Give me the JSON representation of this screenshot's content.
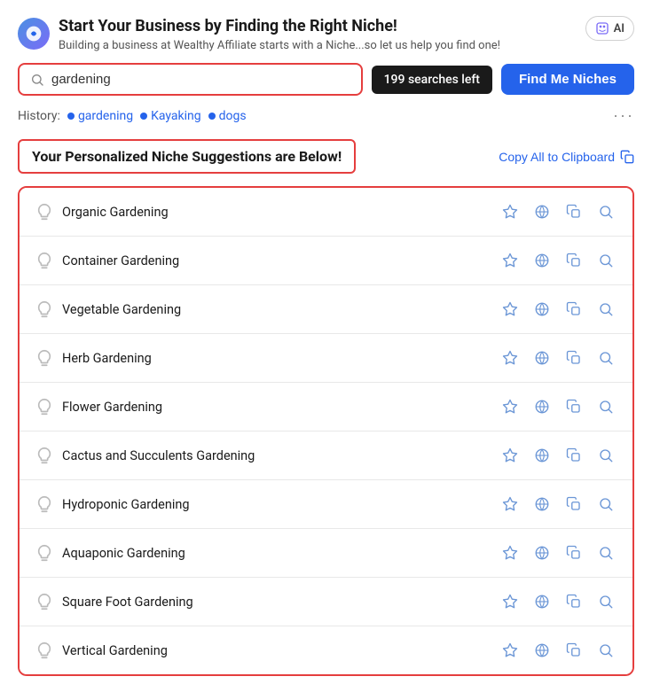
{
  "header": {
    "title": "Start Your Business by Finding the Right Niche!",
    "subtitle": "Building a business at Wealthy Affiliate starts with a Niche...so let us help you find one!",
    "ai_badge": "AI"
  },
  "search": {
    "value": "gardening",
    "placeholder": "gardening",
    "searches_left": "199 searches left",
    "find_button": "Find Me Niches"
  },
  "history": {
    "label": "History:",
    "items": [
      "gardening",
      "Kayaking",
      "dogs"
    ],
    "more_label": "···"
  },
  "suggestions": {
    "title": "Your Personalized Niche Suggestions are Below!",
    "copy_all": "Copy All to Clipboard",
    "niches": [
      "Organic Gardening",
      "Container Gardening",
      "Vegetable Gardening",
      "Herb Gardening",
      "Flower Gardening",
      "Cactus and Succulents Gardening",
      "Hydroponic Gardening",
      "Aquaponic Gardening",
      "Square Foot Gardening",
      "Vertical Gardening"
    ]
  },
  "icons": {
    "search": "🔍",
    "bulb": "💡",
    "star": "☆",
    "copy": "⧉",
    "magnify": "🔍"
  }
}
